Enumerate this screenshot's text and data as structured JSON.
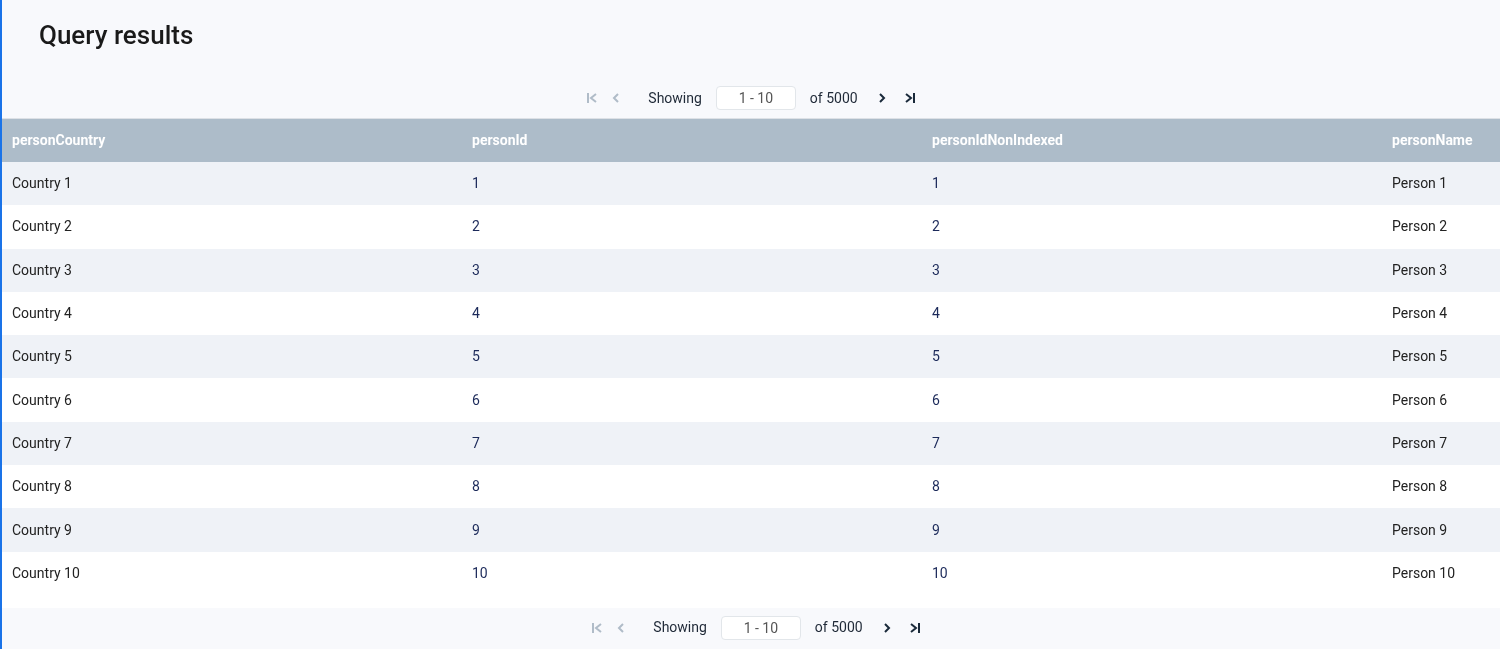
{
  "title": "Query results",
  "pager_top": {
    "first": {
      "disabled": true
    },
    "prev": {
      "disabled": true
    },
    "label": "Showing",
    "range": "1 - 10",
    "total": "of 5000",
    "next": {
      "disabled": false
    },
    "last": {
      "disabled": false
    }
  },
  "table": {
    "columns": [
      "personCountry",
      "personId",
      "personIdNonIndexed",
      "personName"
    ],
    "rows": [
      [
        "Country 1",
        "1",
        "1",
        "Person 1"
      ],
      [
        "Country 2",
        "2",
        "2",
        "Person 2"
      ],
      [
        "Country 3",
        "3",
        "3",
        "Person 3"
      ],
      [
        "Country 4",
        "4",
        "4",
        "Person 4"
      ],
      [
        "Country 5",
        "5",
        "5",
        "Person 5"
      ],
      [
        "Country 6",
        "6",
        "6",
        "Person 6"
      ],
      [
        "Country 7",
        "7",
        "7",
        "Person 7"
      ],
      [
        "Country 8",
        "8",
        "8",
        "Person 8"
      ],
      [
        "Country 9",
        "9",
        "9",
        "Person 9"
      ],
      [
        "Country 10",
        "10",
        "10",
        "Person 10"
      ]
    ]
  },
  "pager_bottom": {
    "first": {
      "disabled": true
    },
    "prev": {
      "disabled": true
    },
    "label": "Showing",
    "range": "1 - 10",
    "total": "of 5000",
    "next": {
      "disabled": false
    },
    "last": {
      "disabled": false
    }
  }
}
